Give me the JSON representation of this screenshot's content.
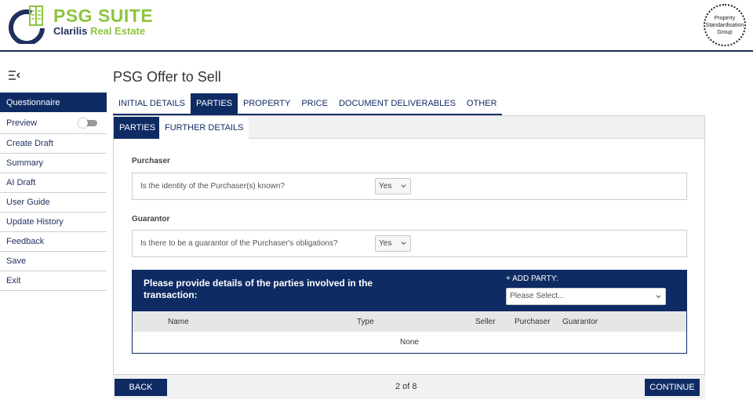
{
  "brand": {
    "title": "PSG SUITE",
    "subtitle_main": "Clarilis",
    "subtitle_accent": "Real Estate",
    "seal_lines": [
      "Property",
      "Standardisation",
      "Group"
    ]
  },
  "colors": {
    "navy": "#0f2b64",
    "green": "#8dc43f",
    "panel_bg": "#f1f1f1"
  },
  "sidebar": {
    "toggle_icon": "menu-collapse-icon",
    "items": [
      {
        "label": "Questionnaire",
        "active": true
      },
      {
        "label": "Preview",
        "toggle": false
      },
      {
        "label": "Create Draft"
      },
      {
        "label": "Summary"
      },
      {
        "label": "AI Draft"
      },
      {
        "label": "User Guide"
      },
      {
        "label": "Update History"
      },
      {
        "label": "Feedback"
      },
      {
        "label": "Save"
      },
      {
        "label": "Exit"
      }
    ]
  },
  "page": {
    "title": "PSG Offer to Sell"
  },
  "tabs": [
    {
      "label": "INITIAL DETAILS"
    },
    {
      "label": "PARTIES",
      "active": true
    },
    {
      "label": "PROPERTY"
    },
    {
      "label": "PRICE"
    },
    {
      "label": "DOCUMENT DELIVERABLES"
    },
    {
      "label": "OTHER"
    }
  ],
  "subtabs": [
    {
      "label": "PARTIES",
      "active": true
    },
    {
      "label": "FURTHER DETAILS"
    }
  ],
  "purchaser": {
    "label": "Purchaser",
    "question": "Is the identity of the Purchaser(s) known?",
    "answer": "Yes"
  },
  "guarantor": {
    "label": "Guarantor",
    "question": "Is there to be a guarantor of the Purchaser's obligations?",
    "answer": "Yes"
  },
  "parties": {
    "title": "Please provide details of the parties involved in the transaction:",
    "add_label": "+ ADD PARTY:",
    "add_placeholder": "Please Select...",
    "columns": [
      "Name",
      "Type",
      "Seller",
      "Purchaser",
      "Guarantor"
    ],
    "empty_text": "None"
  },
  "footer": {
    "back_label": "BACK",
    "page_indicator": "2 of 8",
    "continue_label": "CONTINUE"
  }
}
